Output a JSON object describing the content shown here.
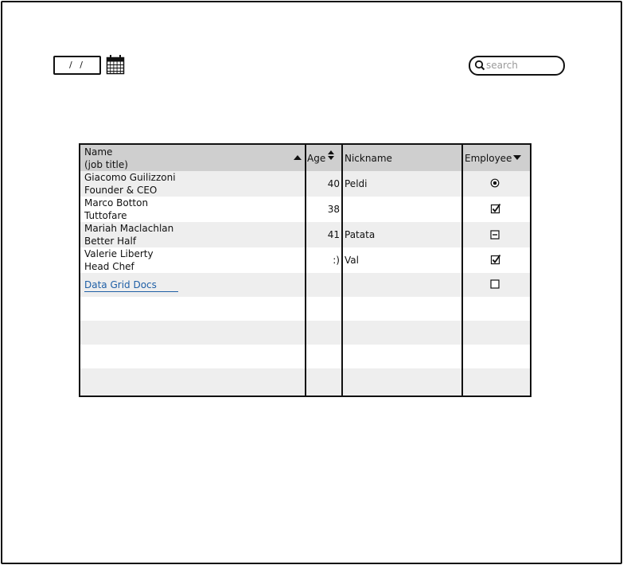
{
  "date_field": {
    "value": "/ /"
  },
  "search": {
    "placeholder": "search"
  },
  "grid": {
    "headers": {
      "name": "Name",
      "name_sub": "(job title)",
      "age": "Age",
      "nickname": "Nickname",
      "employee": "Employee"
    },
    "rows": [
      {
        "name": "Giacomo Guilizzoni",
        "title": "Founder & CEO",
        "age": "40",
        "nickname": "Peldi",
        "employee": "radio-selected"
      },
      {
        "name": "Marco Botton",
        "title": "Tuttofare",
        "age": "38",
        "nickname": "",
        "employee": "checked"
      },
      {
        "name": "Mariah Maclachlan",
        "title": "Better Half",
        "age": "41",
        "nickname": "Patata",
        "employee": "indeterminate"
      },
      {
        "name": "Valerie Liberty",
        "title": "Head Chef",
        "age": ":)",
        "nickname": "Val",
        "employee": "checked"
      }
    ],
    "link_row": {
      "label": "Data Grid Docs",
      "employee": "unchecked"
    }
  }
}
